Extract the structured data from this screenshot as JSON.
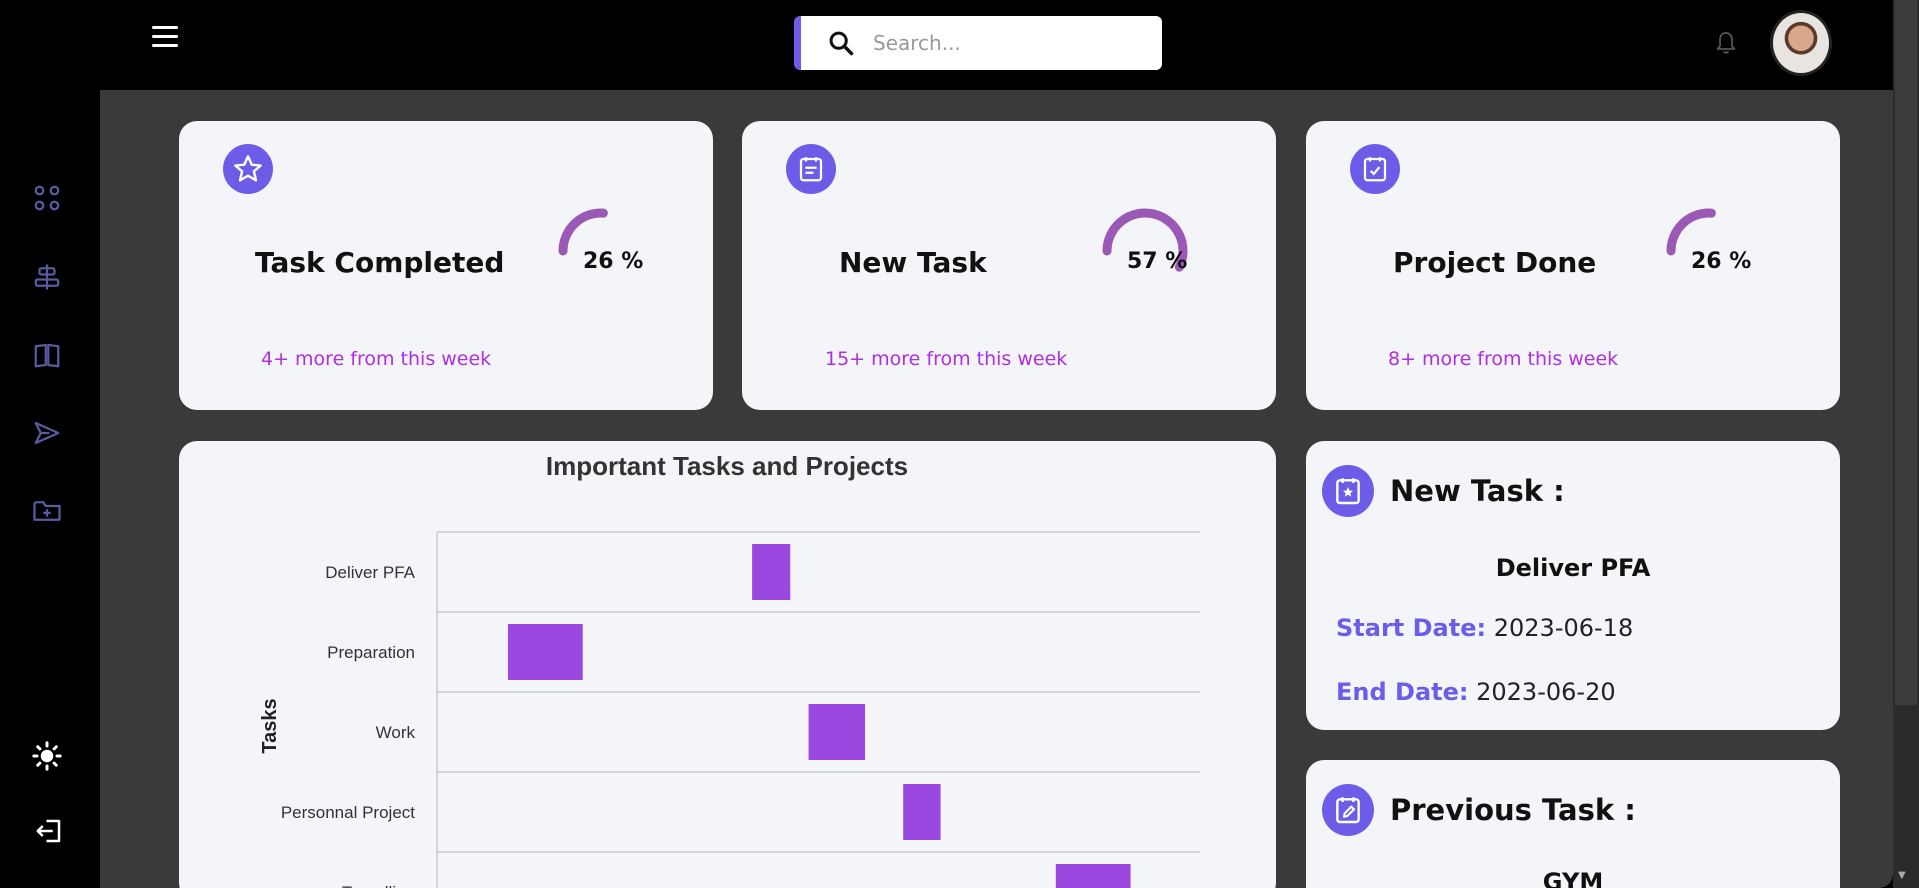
{
  "search": {
    "placeholder": "Search..."
  },
  "icons": {
    "menu": "hamburger-icon",
    "search": "search-icon",
    "notification": "bell-icon",
    "sidebar": [
      "dashboard-icon",
      "align-icon",
      "book-icon",
      "send-icon",
      "folder-add-icon"
    ],
    "theme": "sun-icon",
    "logout": "logout-icon"
  },
  "stats": [
    {
      "icon": "star-icon",
      "title": "Task Completed",
      "percent": 26,
      "percent_label": "26 %",
      "more": "4+ more from this week"
    },
    {
      "icon": "calendar-icon",
      "title": "New Task",
      "percent": 57,
      "percent_label": "57 %",
      "more": "15+ more from this week"
    },
    {
      "icon": "calendar-check-icon",
      "title": "Project Done",
      "percent": 26,
      "percent_label": "26 %",
      "more": "8+ more from this week"
    }
  ],
  "chart_data": {
    "type": "bar",
    "title": "Important Tasks and Projects",
    "ylabel": "Tasks",
    "categories": [
      "Deliver PFA",
      "Preparation",
      "Work",
      "Personnal Project",
      "Travelling"
    ],
    "ranges": [
      [
        0.413,
        0.463
      ],
      [
        0.093,
        0.191
      ],
      [
        0.487,
        0.561
      ],
      [
        0.611,
        0.66
      ],
      [
        0.811,
        0.909
      ]
    ]
  },
  "new_task": {
    "heading": "New Task :",
    "name": "Deliver PFA",
    "start_label": "Start Date:",
    "start_value": "2023-06-18",
    "end_label": "End Date:",
    "end_value": "2023-06-20"
  },
  "previous_task": {
    "heading": "Previous Task :",
    "name": "GYM"
  },
  "colors": {
    "accent": "#6c5ce7",
    "gauge": "#9b59b6",
    "bar": "#9b48e0",
    "more_text": "#b02ee0"
  }
}
